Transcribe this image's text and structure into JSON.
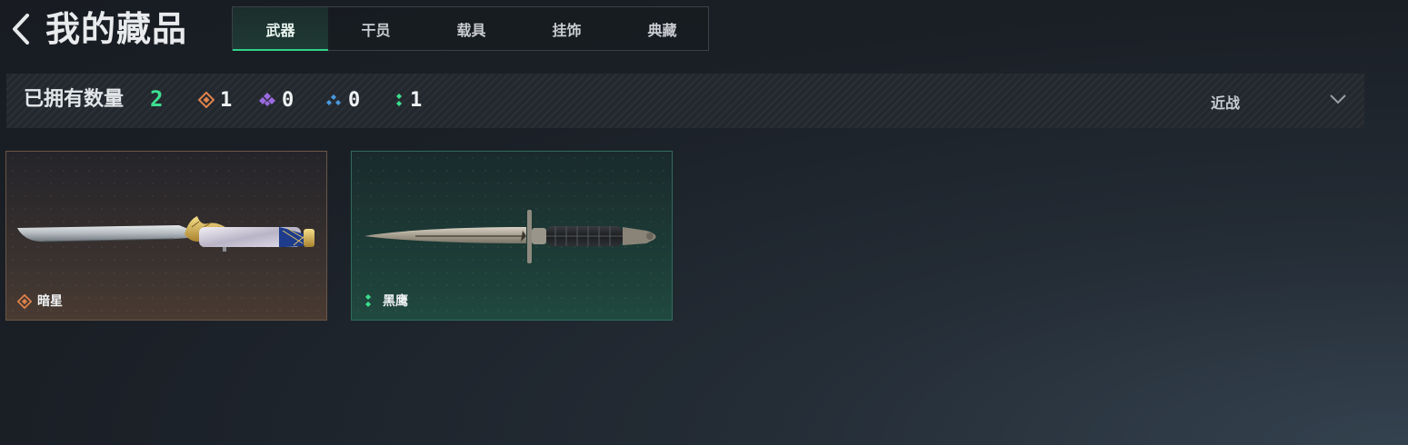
{
  "header": {
    "title": "我的藏品"
  },
  "tabs": [
    {
      "label": "武器",
      "active": true
    },
    {
      "label": "干员",
      "active": false
    },
    {
      "label": "载具",
      "active": false
    },
    {
      "label": "挂饰",
      "active": false
    },
    {
      "label": "典藏",
      "active": false
    }
  ],
  "stats": {
    "label": "已拥有数量",
    "total": "2",
    "rarities": [
      {
        "icon": "orange-diamond-icon",
        "color": "#e0824a",
        "count": "1"
      },
      {
        "icon": "purple-diamond-icon",
        "color": "#9b6ae0",
        "count": "0"
      },
      {
        "icon": "blue-diamond-icon",
        "color": "#4a9ae0",
        "count": "0"
      },
      {
        "icon": "green-diamond-icon",
        "color": "#3de08f",
        "count": "1"
      }
    ]
  },
  "filter": {
    "selected": "近战"
  },
  "items": [
    {
      "name": "暗星",
      "rarity": "orange",
      "icon": "orange-diamond-icon"
    },
    {
      "name": "黑鹰",
      "rarity": "green",
      "icon": "green-diamond-icon"
    }
  ],
  "colors": {
    "accent": "#2fd38c",
    "orange": "#e0824a",
    "purple": "#9b6ae0",
    "blue": "#4a9ae0",
    "green": "#3de08f"
  }
}
